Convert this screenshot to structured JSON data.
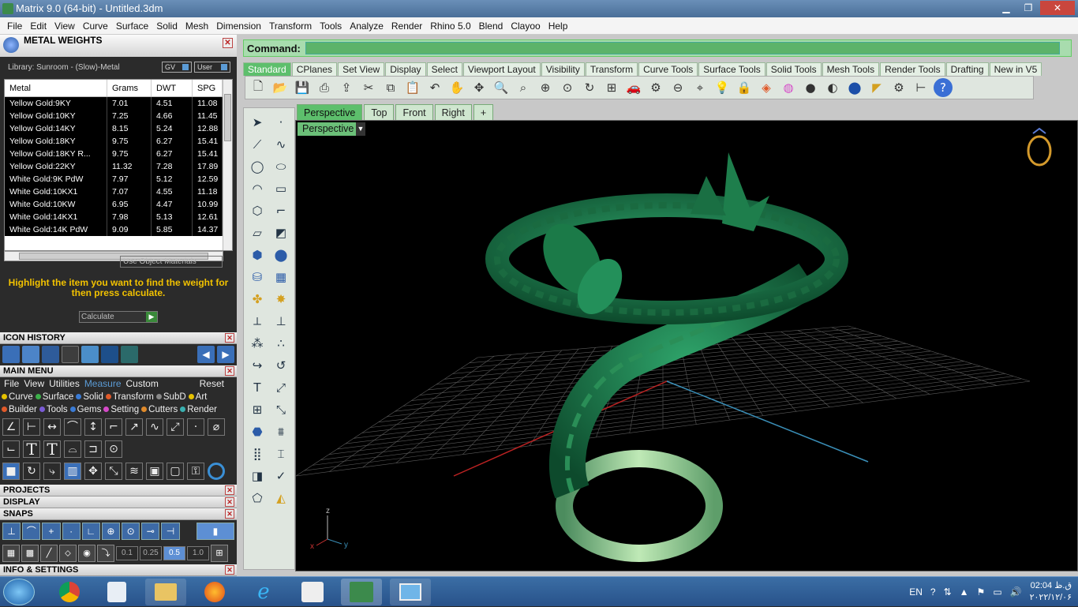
{
  "window": {
    "title": "Matrix 9.0 (64-bit) - Untitled.3dm"
  },
  "menu": [
    "File",
    "Edit",
    "View",
    "Curve",
    "Surface",
    "Solid",
    "Mesh",
    "Dimension",
    "Transform",
    "Tools",
    "Analyze",
    "Render",
    "Rhino 5.0",
    "Blend",
    "Clayoo",
    "Help"
  ],
  "metal_weights": {
    "title": "METAL WEIGHTS",
    "library": "Library: Sunroom - (Slow)-Metal",
    "gv_label": "GV",
    "user_label": "User",
    "columns": [
      "Metal",
      "Grams",
      "DWT",
      "SPG"
    ],
    "rows": [
      [
        "Yellow Gold:9KY",
        "7.01",
        "4.51",
        "11.08"
      ],
      [
        "Yellow Gold:10KY",
        "7.25",
        "4.66",
        "11.45"
      ],
      [
        "Yellow Gold:14KY",
        "8.15",
        "5.24",
        "12.88"
      ],
      [
        "Yellow Gold:18KY",
        "9.75",
        "6.27",
        "15.41"
      ],
      [
        "Yellow Gold:18KY R...",
        "9.75",
        "6.27",
        "15.41"
      ],
      [
        "Yellow Gold:22KY",
        "11.32",
        "7.28",
        "17.89"
      ],
      [
        "White Gold:9K PdW",
        "7.97",
        "5.12",
        "12.59"
      ],
      [
        "White Gold:10KX1",
        "7.07",
        "4.55",
        "11.18"
      ],
      [
        "White Gold:10KW",
        "6.95",
        "4.47",
        "10.99"
      ],
      [
        "White Gold:14KX1",
        "7.98",
        "5.13",
        "12.61"
      ],
      [
        "White Gold:14K PdW",
        "9.09",
        "5.85",
        "14.37"
      ]
    ],
    "use_object_materials": "Use Object Materials",
    "hint": "Highlight the item you want to find the weight for then press calculate.",
    "calculate": "Calculate"
  },
  "panels": {
    "icon_history": "ICON HISTORY",
    "main_menu": "MAIN MENU",
    "projects": "PROJECTS",
    "display": "DISPLAY",
    "snaps": "SNAPS",
    "info": "INFO & SETTINGS"
  },
  "main_menu": {
    "tabs": [
      "File",
      "View",
      "Utilities",
      "Measure",
      "Custom"
    ],
    "active_tab": "Measure",
    "reset": "Reset",
    "categories": [
      {
        "label": "Curve",
        "color": "#e6c200"
      },
      {
        "label": "Surface",
        "color": "#3cb04a"
      },
      {
        "label": "Solid",
        "color": "#3a7bd5"
      },
      {
        "label": "Transform",
        "color": "#e05a2a"
      },
      {
        "label": "SubD",
        "color": "#888888"
      },
      {
        "label": "Art",
        "color": "#e6c200"
      },
      {
        "label": "Builder",
        "color": "#e05a2a"
      },
      {
        "label": "Tools",
        "color": "#7a5bd5"
      },
      {
        "label": "Gems",
        "color": "#3a7bd5"
      },
      {
        "label": "Setting",
        "color": "#d54ac8"
      },
      {
        "label": "Cutters",
        "color": "#e08a2a"
      },
      {
        "label": "Render",
        "color": "#3ab0b0"
      }
    ]
  },
  "snaps": {
    "values": [
      "0.1",
      "0.25",
      "0.5",
      "1.0"
    ],
    "selected": "0.5"
  },
  "command": {
    "label": "Command:",
    "value": ""
  },
  "toolbar_tabs": [
    "Standard",
    "CPlanes",
    "Set View",
    "Display",
    "Select",
    "Viewport Layout",
    "Visibility",
    "Transform",
    "Curve Tools",
    "Surface Tools",
    "Solid Tools",
    "Mesh Tools",
    "Render Tools",
    "Drafting",
    "New in V5"
  ],
  "active_toolbar_tab": "Standard",
  "viewport_tabs": [
    "Perspective",
    "Top",
    "Front",
    "Right",
    "+"
  ],
  "active_viewport_tab": "Perspective",
  "viewport": {
    "label": "Perspective",
    "axes": {
      "z": "z",
      "x": "x",
      "y": "y"
    }
  },
  "taskbar": {
    "lang": "EN",
    "time": "02:04 ق.ظ",
    "date": "۲۰۲۲/۱۲/۰۶"
  }
}
